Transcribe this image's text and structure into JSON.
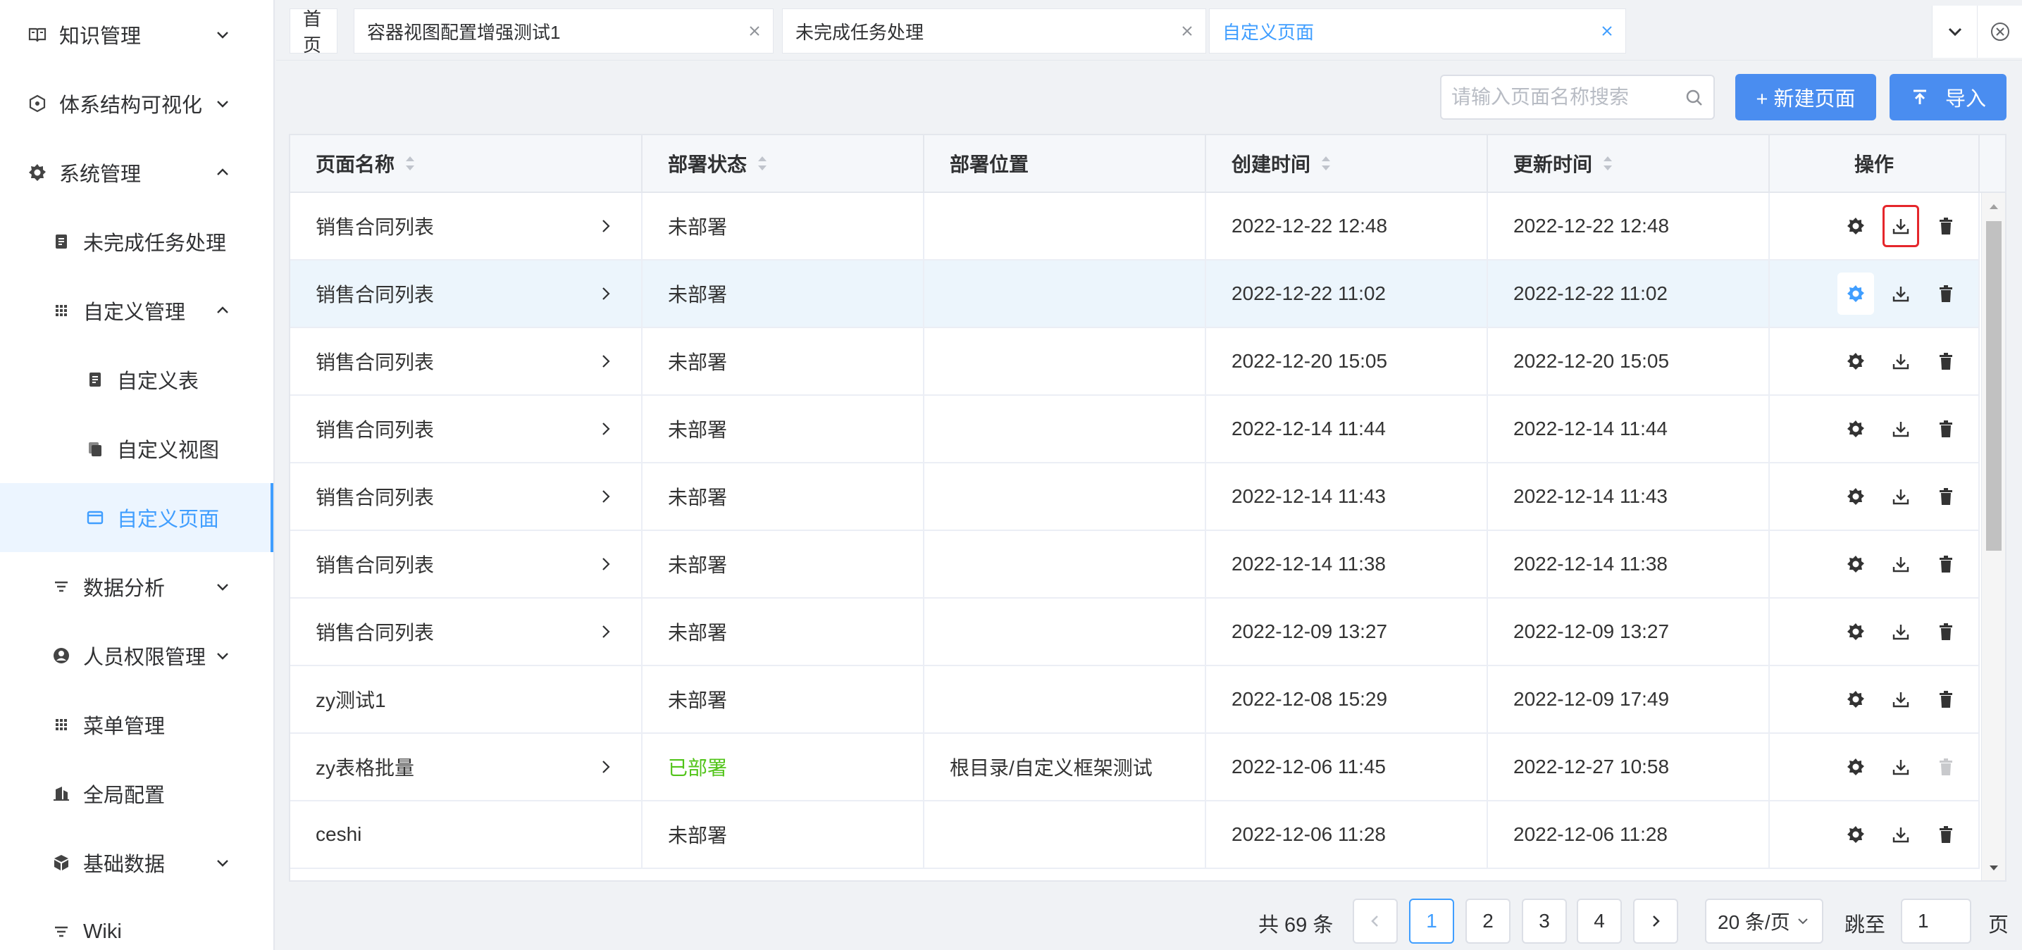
{
  "sidebar": {
    "items": [
      {
        "label": "知识管理",
        "icon": "book-icon",
        "level": 1,
        "arrow": "down"
      },
      {
        "label": "体系结构可视化",
        "icon": "hexagon-icon",
        "level": 1,
        "arrow": "down"
      },
      {
        "label": "系统管理",
        "icon": "gear-icon",
        "level": 1,
        "arrow": "up"
      },
      {
        "label": "未完成任务处理",
        "icon": "document-icon",
        "level": 2,
        "arrow": ""
      },
      {
        "label": "自定义管理",
        "icon": "grid-icon",
        "level": 2,
        "arrow": "up"
      },
      {
        "label": "自定义表",
        "icon": "document-icon",
        "level": 3,
        "arrow": ""
      },
      {
        "label": "自定义视图",
        "icon": "copy-icon",
        "level": 3,
        "arrow": ""
      },
      {
        "label": "自定义页面",
        "icon": "window-icon",
        "level": 3,
        "arrow": "",
        "active": true
      },
      {
        "label": "数据分析",
        "icon": "filter-icon",
        "level": 2,
        "arrow": "down"
      },
      {
        "label": "人员权限管理",
        "icon": "user-icon",
        "level": 2,
        "arrow": "down"
      },
      {
        "label": "菜单管理",
        "icon": "grid-icon",
        "level": 2,
        "arrow": ""
      },
      {
        "label": "全局配置",
        "icon": "building-icon",
        "level": 2,
        "arrow": ""
      },
      {
        "label": "基础数据",
        "icon": "cube-icon",
        "level": 2,
        "arrow": "down"
      },
      {
        "label": "Wiki",
        "icon": "filter-icon",
        "level": 2,
        "arrow": ""
      }
    ]
  },
  "tabs": [
    {
      "label": "首页",
      "closable": false
    },
    {
      "label": "容器视图配置增强测试1",
      "closable": true
    },
    {
      "label": "未完成任务处理",
      "closable": true
    },
    {
      "label": "自定义页面",
      "closable": true,
      "active": true
    }
  ],
  "toolbar": {
    "search_placeholder": "请输入页面名称搜索",
    "new_label": "+ 新建页面",
    "import_label": "导入"
  },
  "table": {
    "columns": [
      "页面名称",
      "部署状态",
      "部署位置",
      "创建时间",
      "更新时间",
      "操作"
    ],
    "rows": [
      {
        "name": "销售合同列表",
        "status": "未部署",
        "location": "",
        "created": "2022-12-22 12:48",
        "updated": "2022-12-22 12:48",
        "expand": true
      },
      {
        "name": "销售合同列表",
        "status": "未部署",
        "location": "",
        "created": "2022-12-22 11:02",
        "updated": "2022-12-22 11:02",
        "expand": true
      },
      {
        "name": "销售合同列表",
        "status": "未部署",
        "location": "",
        "created": "2022-12-20 15:05",
        "updated": "2022-12-20 15:05",
        "expand": true
      },
      {
        "name": "销售合同列表",
        "status": "未部署",
        "location": "",
        "created": "2022-12-14 11:44",
        "updated": "2022-12-14 11:44",
        "expand": true
      },
      {
        "name": "销售合同列表",
        "status": "未部署",
        "location": "",
        "created": "2022-12-14 11:43",
        "updated": "2022-12-14 11:43",
        "expand": true
      },
      {
        "name": "销售合同列表",
        "status": "未部署",
        "location": "",
        "created": "2022-12-14 11:38",
        "updated": "2022-12-14 11:38",
        "expand": true
      },
      {
        "name": "销售合同列表",
        "status": "未部署",
        "location": "",
        "created": "2022-12-09 13:27",
        "updated": "2022-12-09 13:27",
        "expand": true
      },
      {
        "name": "zy测试1",
        "status": "未部署",
        "location": "",
        "created": "2022-12-08 15:29",
        "updated": "2022-12-09 17:49",
        "expand": false
      },
      {
        "name": "zy表格批量",
        "status": "已部署",
        "location": "根目录/自定义框架测试",
        "created": "2022-12-06 11:45",
        "updated": "2022-12-27 10:58",
        "expand": true,
        "deployed": true
      },
      {
        "name": "ceshi",
        "status": "未部署",
        "location": "",
        "created": "2022-12-06 11:28",
        "updated": "2022-12-06 11:28",
        "expand": false
      }
    ]
  },
  "pagination": {
    "total_label": "共 69 条",
    "pages": [
      "1",
      "2",
      "3",
      "4"
    ],
    "current": "1",
    "page_size_label": "20 条/页",
    "jump_label": "跳至",
    "jump_value": "1",
    "page_suffix": "页"
  },
  "colors": {
    "accent": "#409eff",
    "button": "#4a8df0",
    "deployed": "#52c41a",
    "highlight_box": "#e5262b"
  }
}
